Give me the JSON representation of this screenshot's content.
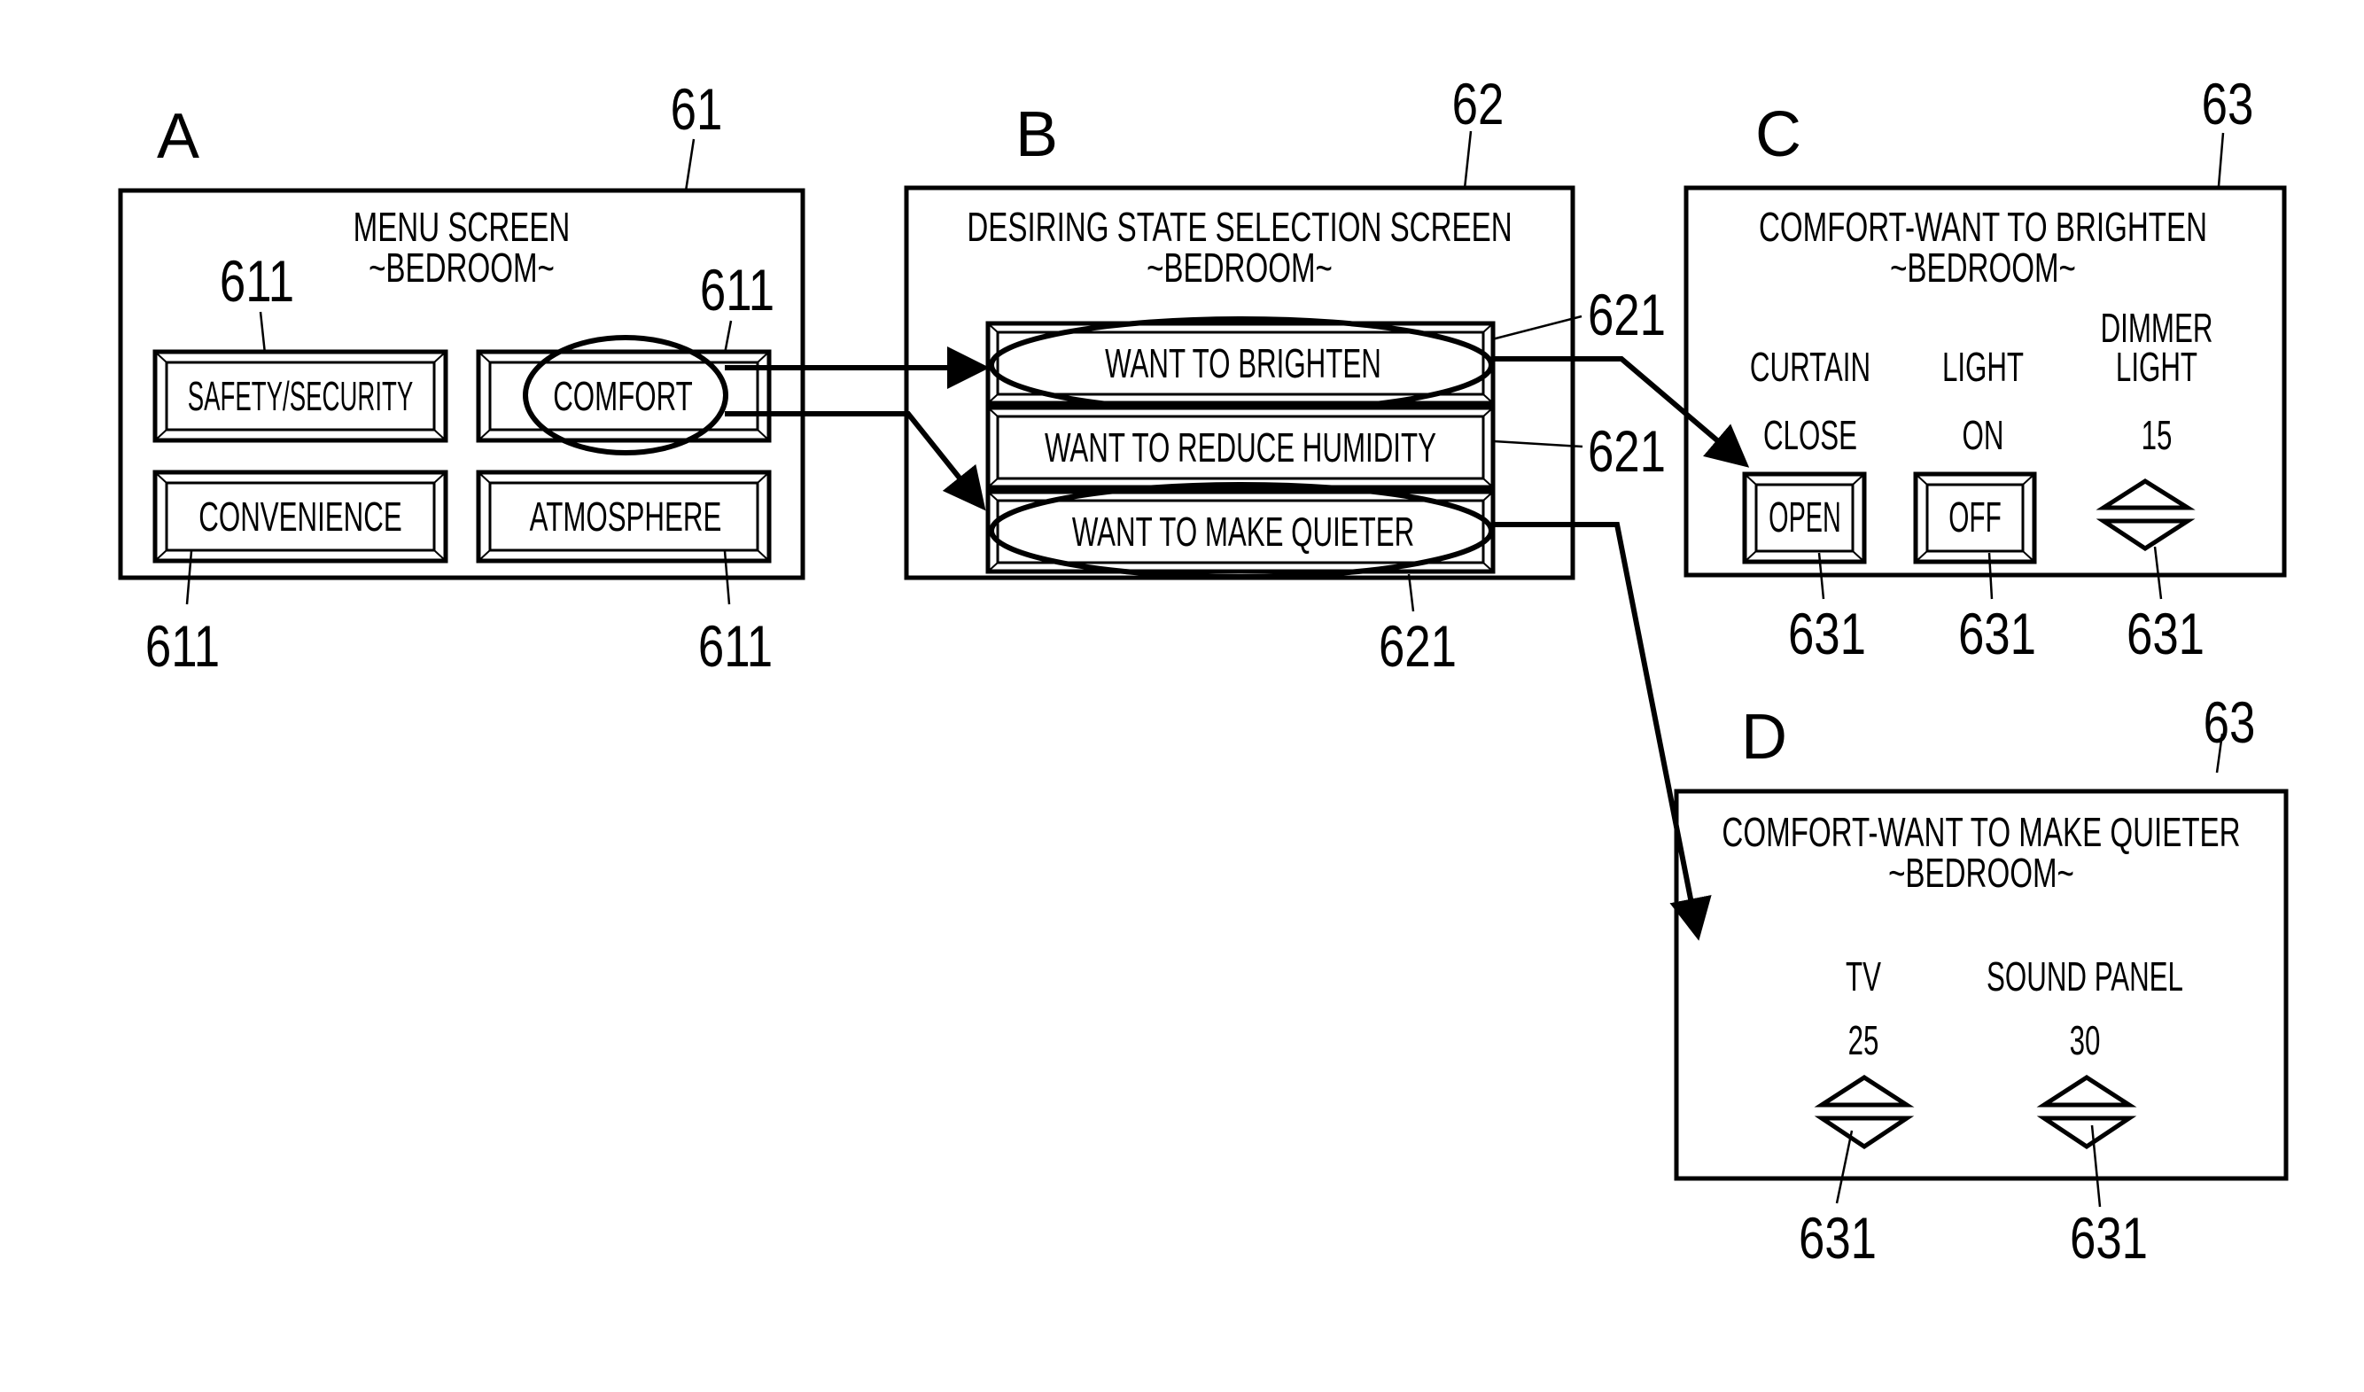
{
  "figure_labels": {
    "a": "A",
    "b": "B",
    "c": "C",
    "d": "D"
  },
  "ref_numerals": {
    "menu_screen": "61",
    "menu_button": "611",
    "selection_screen": "62",
    "selection_button": "621",
    "operation_screen": "63",
    "operation_control": "631"
  },
  "screen_a": {
    "title": "MENU SCREEN",
    "room": "~BEDROOM~",
    "buttons": [
      {
        "label": "SAFETY/SECURITY",
        "selected": false
      },
      {
        "label": "COMFORT",
        "selected": true
      },
      {
        "label": "CONVENIENCE",
        "selected": false
      },
      {
        "label": "ATMOSPHERE",
        "selected": false
      }
    ]
  },
  "screen_b": {
    "title": "DESIRING STATE SELECTION SCREEN",
    "room": "~BEDROOM~",
    "buttons": [
      {
        "label": "WANT TO BRIGHTEN",
        "selected": true
      },
      {
        "label": "WANT TO REDUCE HUMIDITY",
        "selected": false
      },
      {
        "label": "WANT TO MAKE QUIETER",
        "selected": true
      }
    ]
  },
  "screen_c": {
    "title": "COMFORT-WANT TO BRIGHTEN",
    "room": "~BEDROOM~",
    "devices": [
      {
        "name": "CURTAIN",
        "state": "CLOSE",
        "control": "button",
        "control_label": "OPEN"
      },
      {
        "name": "LIGHT",
        "state": "ON",
        "control": "button",
        "control_label": "OFF"
      },
      {
        "name_line1": "DIMMER",
        "name_line2": "LIGHT",
        "state": "15",
        "control": "up-down-spinner"
      }
    ]
  },
  "screen_d": {
    "title": "COMFORT-WANT TO MAKE QUIETER",
    "room": "~BEDROOM~",
    "devices": [
      {
        "name": "TV",
        "state": "25",
        "control": "up-down-spinner"
      },
      {
        "name": "SOUND PANEL",
        "state": "30",
        "control": "up-down-spinner"
      }
    ]
  },
  "flow": [
    {
      "from": "COMFORT",
      "to": "WANT TO BRIGHTEN"
    },
    {
      "from": "COMFORT",
      "to": "WANT TO MAKE QUIETER"
    },
    {
      "from": "WANT TO BRIGHTEN",
      "to": "COMFORT-WANT TO BRIGHTEN"
    },
    {
      "from": "WANT TO MAKE QUIETER",
      "to": "COMFORT-WANT TO MAKE QUIETER"
    }
  ]
}
